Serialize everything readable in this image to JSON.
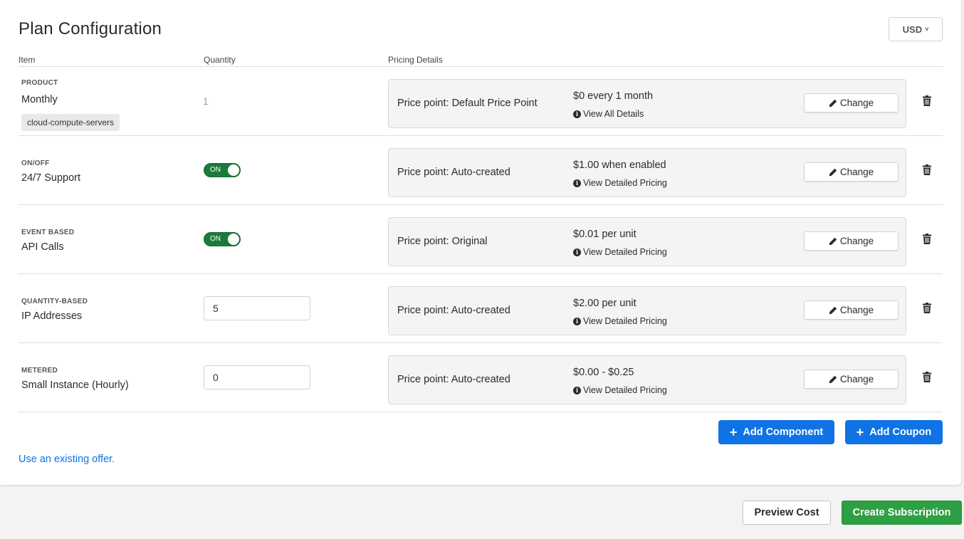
{
  "header": {
    "title": "Plan Configuration",
    "currency": "USD"
  },
  "columns": {
    "item": "Item",
    "quantity": "Quantity",
    "pricing": "Pricing Details"
  },
  "rows": [
    {
      "kind": "PRODUCT",
      "name": "Monthly",
      "handle": "cloud-compute-servers",
      "quantity": "1",
      "price_point": "Price point: Default Price Point",
      "price": "$0 every 1 month",
      "link": "View All Details",
      "change": "Change"
    },
    {
      "kind": "ON/OFF",
      "name": "24/7 Support",
      "toggle": "ON",
      "price_point": "Price point: Auto-created",
      "price": "$1.00 when enabled",
      "link": "View Detailed Pricing",
      "change": "Change"
    },
    {
      "kind": "EVENT BASED",
      "name": "API Calls",
      "toggle": "ON",
      "price_point": "Price point: Original",
      "price": "$0.01 per unit",
      "link": "View Detailed Pricing",
      "change": "Change"
    },
    {
      "kind": "QUANTITY-BASED",
      "name": "IP Addresses",
      "quantity": "5",
      "price_point": "Price point: Auto-created",
      "price": "$2.00 per unit",
      "link": "View Detailed Pricing",
      "change": "Change"
    },
    {
      "kind": "METERED",
      "name": "Small Instance (Hourly)",
      "quantity": "0",
      "price_point": "Price point: Auto-created",
      "price": "$0.00 - $0.25",
      "link": "View Detailed Pricing",
      "change": "Change"
    }
  ],
  "actions": {
    "add_component": "Add Component",
    "add_coupon": "Add Coupon",
    "existing_offer": "Use an existing offer."
  },
  "footer": {
    "preview_cost": "Preview Cost",
    "create_subscription": "Create Subscription"
  },
  "colors": {
    "accent_blue": "#0f73e6",
    "toggle_green": "#1b7a3a",
    "create_green": "#2ea043"
  }
}
